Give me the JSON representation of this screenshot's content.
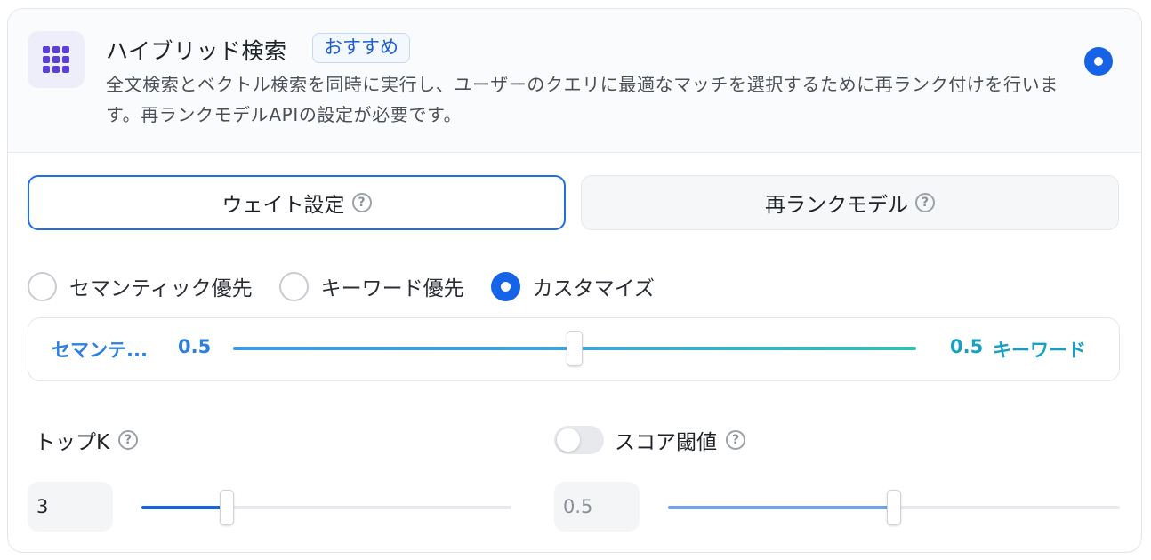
{
  "header": {
    "icon": "grid-dots-icon",
    "title": "ハイブリッド検索",
    "badge": "おすすめ",
    "description": "全文検索とベクトル検索を同時に実行し、ユーザーのクエリに最適なマッチを選択するために再ランク付けを行います。再ランクモデルAPIの設定が必要です。",
    "selected": true
  },
  "tabs": [
    {
      "label": "ウェイト設定",
      "active": true
    },
    {
      "label": "再ランクモデル",
      "active": false
    }
  ],
  "help_glyph": "?",
  "presets": [
    {
      "label": "セマンティック優先",
      "selected": false
    },
    {
      "label": "キーワード優先",
      "selected": false
    },
    {
      "label": "カスタマイズ",
      "selected": true
    }
  ],
  "weight": {
    "left_label": "セマンテ...",
    "left_value": "0.5",
    "right_value": "0.5",
    "right_label": "キーワード",
    "position": 0.5,
    "colors": {
      "semantic": "#2f7fe0",
      "keyword": "#18a0c0"
    }
  },
  "top_k": {
    "label": "トップK",
    "value": "3",
    "slider_fraction": 0.23
  },
  "score_threshold": {
    "label": "スコア閾値",
    "enabled": false,
    "value": "0.5",
    "slider_fraction": 0.5
  },
  "accent": "#1763e8"
}
